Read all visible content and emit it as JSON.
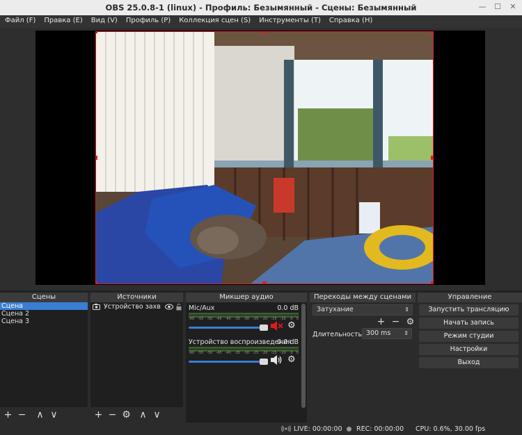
{
  "window": {
    "title": "OBS 25.0.8-1 (linux) - Профиль: Безымянный - Сцены: Безымянный"
  },
  "menu": [
    "Файл (F)",
    "Правка (E)",
    "Вид (V)",
    "Профиль (P)",
    "Коллекция сцен (S)",
    "Инструменты (T)",
    "Справка (H)"
  ],
  "docks": {
    "scenes": {
      "title": "Сцены",
      "items": [
        "Сцена",
        "Сцена 2",
        "Сцена 3"
      ],
      "selected_index": 0
    },
    "sources": {
      "title": "Источники",
      "items": [
        {
          "name": "Устройство захв",
          "icon": "camera-icon",
          "visible": true,
          "locked": false
        }
      ]
    },
    "mixer": {
      "title": "Микшер аудио",
      "ticks": [
        "-60",
        "-55",
        "-50",
        "-45",
        "-40",
        "-35",
        "-30",
        "-25",
        "-20",
        "-15",
        "-10",
        "-5",
        "0"
      ],
      "channels": [
        {
          "name": "Mic/Aux",
          "level": "0.0 dB",
          "muted": true
        },
        {
          "name": "Устройство воспроизведения",
          "level": "0.0 dB",
          "muted": false
        }
      ]
    },
    "transitions": {
      "title": "Переходы между сценами",
      "selected": "Затухание",
      "duration_label": "Длительность",
      "duration_value": "300 ms"
    },
    "controls": {
      "title": "Управление",
      "buttons": [
        "Запустить трансляцию",
        "Начать запись",
        "Режим студии",
        "Настройки",
        "Выход"
      ]
    }
  },
  "status": {
    "live": "LIVE: 00:00:00",
    "rec": "REC: 00:00:00",
    "cpu": "CPU: 0.6%, 30.00 fps"
  },
  "colors": {
    "selection": "#3a7ed3",
    "source_border": "#e01b1b",
    "mute": "#e01b1b"
  }
}
